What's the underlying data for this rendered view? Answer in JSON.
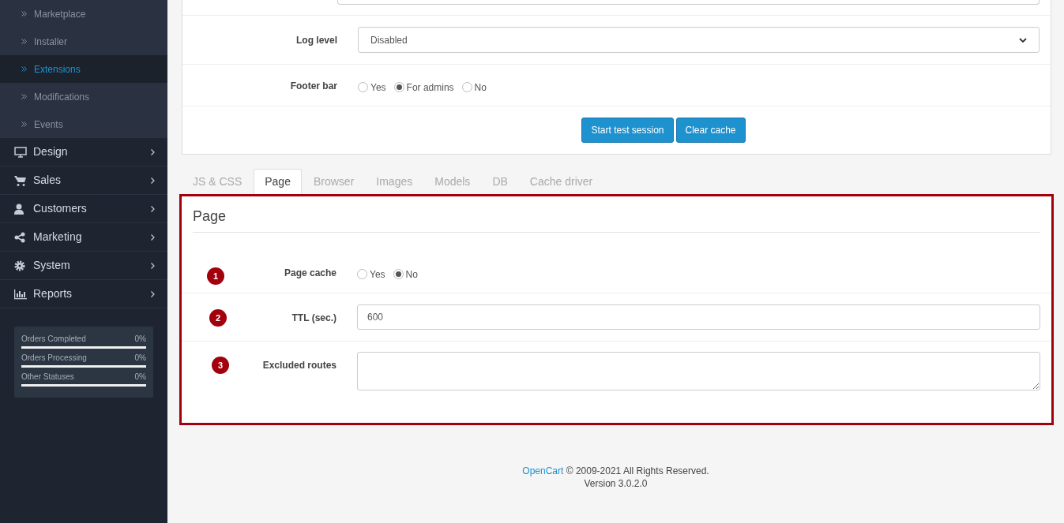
{
  "sidebar": {
    "items": [
      {
        "kind": "subitem",
        "label": "Marketplace",
        "selected": false
      },
      {
        "kind": "subitem",
        "label": "Installer",
        "selected": false
      },
      {
        "kind": "subitem",
        "label": "Extensions",
        "selected": true
      },
      {
        "kind": "subitem",
        "label": "Modifications",
        "selected": false
      },
      {
        "kind": "subitem",
        "label": "Events",
        "selected": false
      },
      {
        "kind": "menu",
        "label": "Design",
        "selected": false
      },
      {
        "kind": "menu",
        "label": "Sales",
        "selected": false
      },
      {
        "kind": "menu",
        "label": "Customers",
        "selected": false
      },
      {
        "kind": "menu",
        "label": "Marketing",
        "selected": false
      },
      {
        "kind": "menu",
        "label": "System",
        "selected": false
      },
      {
        "kind": "menu",
        "label": "Reports",
        "selected": false
      }
    ],
    "stats": [
      {
        "label": "Orders Completed",
        "reading": "0%",
        "level": 0
      },
      {
        "label": "Orders Processing",
        "reading": "0%",
        "level": 0
      },
      {
        "label": "Other Statuses",
        "reading": "0%",
        "level": 0
      }
    ]
  },
  "settings_panel": {
    "rows": [
      {
        "kind": "select",
        "label": "Log level",
        "value": "Disabled"
      },
      {
        "kind": "radio",
        "label": "Footer bar",
        "options": [
          {
            "label": "Yes",
            "selected": false
          },
          {
            "label": "For admins",
            "selected": true
          },
          {
            "label": "No",
            "selected": false
          }
        ]
      }
    ],
    "buttons": [
      "Start test session",
      "Clear cache"
    ]
  },
  "tabs": [
    {
      "label": "JS & CSS",
      "selected": false
    },
    {
      "label": "Page",
      "selected": true
    },
    {
      "label": "Browser",
      "selected": false
    },
    {
      "label": "Images",
      "selected": false
    },
    {
      "label": "Models",
      "selected": false
    },
    {
      "label": "DB",
      "selected": false
    },
    {
      "label": "Cache driver",
      "selected": false
    }
  ],
  "page_panel": {
    "title": "Page",
    "rows": [
      {
        "kind": "radio",
        "marker": "1",
        "label": "Page cache",
        "options": [
          {
            "label": "Yes",
            "selected": false
          },
          {
            "label": "No",
            "selected": true
          }
        ]
      },
      {
        "kind": "text",
        "marker": "2",
        "label": "TTL (sec.)",
        "value": "600"
      },
      {
        "kind": "textarea",
        "marker": "3",
        "label": "Excluded routes",
        "value": ""
      }
    ]
  },
  "footer": {
    "link": "OpenCart",
    "text": "© 2009-2021 All Rights Reserved.",
    "version": "Version 3.0.2.0"
  }
}
